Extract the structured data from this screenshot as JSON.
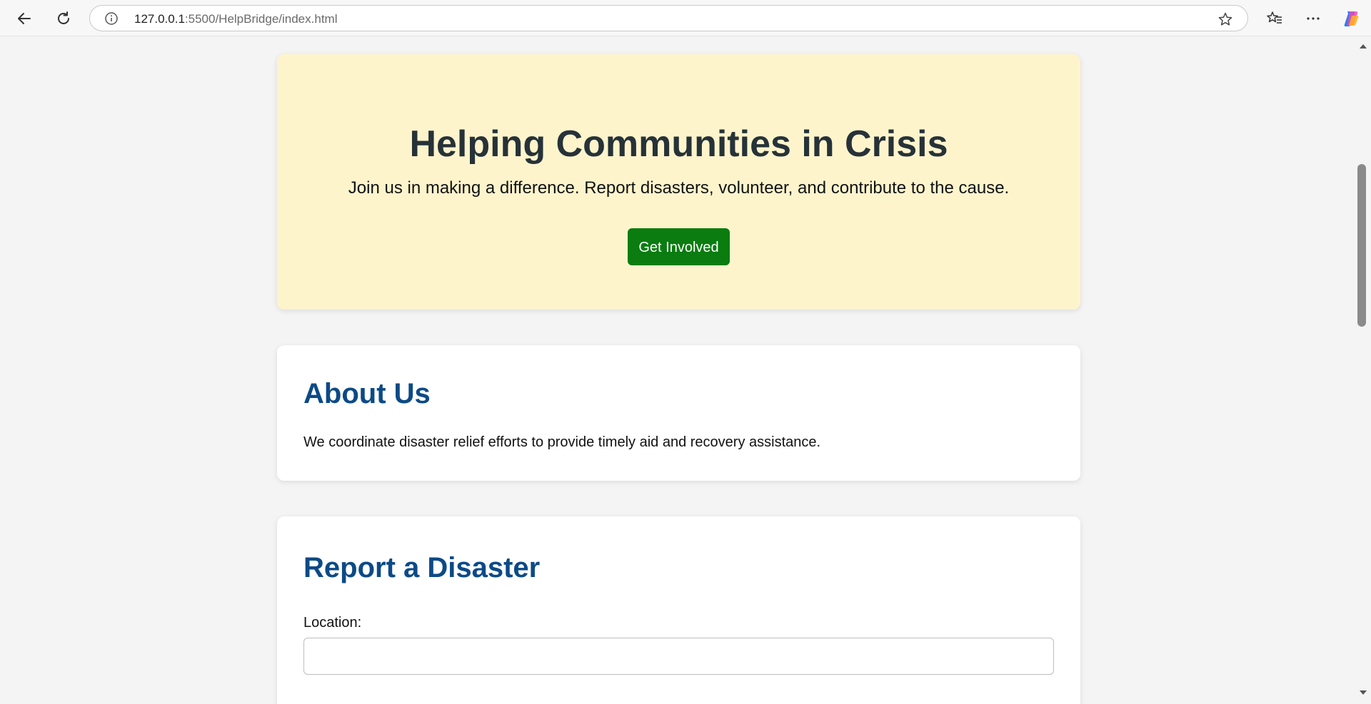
{
  "browser": {
    "url_host": "127.0.0.1",
    "url_rest": ":5500/HelpBridge/index.html"
  },
  "hero": {
    "title": "Helping Communities in Crisis",
    "subtitle": "Join us in making a difference. Report disasters, volunteer, and contribute to the cause.",
    "cta_label": "Get Involved"
  },
  "about": {
    "heading": "About Us",
    "text": "We coordinate disaster relief efforts to provide timely aid and recovery assistance."
  },
  "report": {
    "heading": "Report a Disaster",
    "location_label": "Location:",
    "location_value": ""
  },
  "colors": {
    "hero_bg": "#fef4cc",
    "cta_bg": "#0a7c10",
    "heading_blue": "#0c4a86",
    "page_bg": "#f4f4f4"
  }
}
